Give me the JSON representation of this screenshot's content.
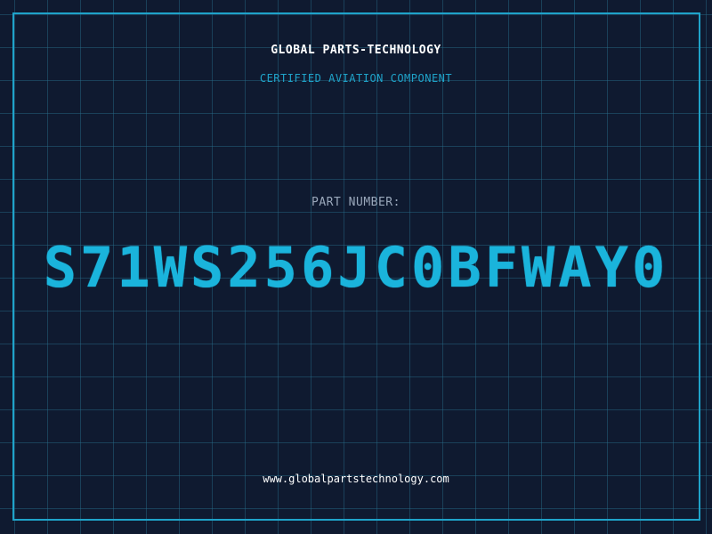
{
  "header": {
    "company": "GLOBAL PARTS-TECHNOLOGY",
    "tagline": "CERTIFIED AVIATION COMPONENT"
  },
  "part": {
    "label": "PART NUMBER:",
    "number": "S71WS256JC0BFWAY0"
  },
  "footer": {
    "website": "www.globalpartstechnology.com"
  },
  "colors": {
    "background": "#0f1a30",
    "accent": "#1fa3c9",
    "grid": "#286e8c"
  }
}
